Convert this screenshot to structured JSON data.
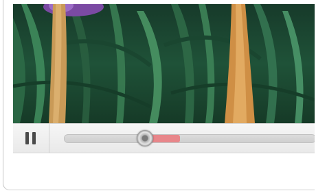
{
  "player": {
    "state": "playing",
    "controls": {
      "pause_button_icon": "pause-icon",
      "progress_fraction": 0.32,
      "buffered_fraction": 0.46,
      "buffer_color": "#e8868a"
    }
  },
  "colors": {
    "control_bar": "#eeeeee",
    "track": "#d4d4d4",
    "pause_icon": "#4a4a4a"
  }
}
